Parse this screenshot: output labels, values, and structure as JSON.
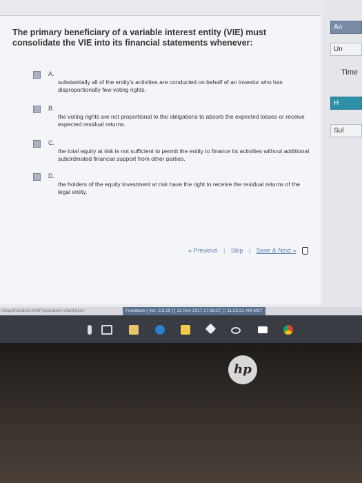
{
  "question": {
    "text": "The primary beneficiary of a variable interest entity (VIE) must consolidate the VIE into its financial statements whenever:"
  },
  "options": [
    {
      "letter": "A.",
      "text": "substantially all of the entity's activities are conducted on behalf of an investor who has disproportionally few voting rights."
    },
    {
      "letter": "B.",
      "text": "the voting rights are not proportional to the obligations to absorb the expected losses or receive expected residual returns."
    },
    {
      "letter": "C.",
      "text": "the total equity at risk is not sufficient to permit the entity to finance its activities without additional subordinated financial support from other parties."
    },
    {
      "letter": "D.",
      "text": "the holders of the equity investment at risk have the right to receive the residual returns of the legal entity."
    }
  ],
  "nav": {
    "previous": "« Previous",
    "skip": "Skip",
    "save_next": "Save & Next »"
  },
  "right_panel": {
    "answer": "An",
    "un": "Un",
    "time": "Time",
    "h": "H",
    "sub": "Sul"
  },
  "status_bar": {
    "url": "m/quiz/student.html?operation=startQuiz#",
    "info": "Feedback  [ Ver: 2.8.29 ] [ 13 Nov 2017 17:36:27 ] [ 11:55:21 AM MST"
  },
  "taskbar": {
    "icons": [
      "mic-icon",
      "task-view-icon",
      "files-icon",
      "edge-icon",
      "store-icon",
      "dropbox-icon",
      "infinity-icon",
      "mail-icon",
      "chrome-icon"
    ]
  },
  "brand": "hp"
}
